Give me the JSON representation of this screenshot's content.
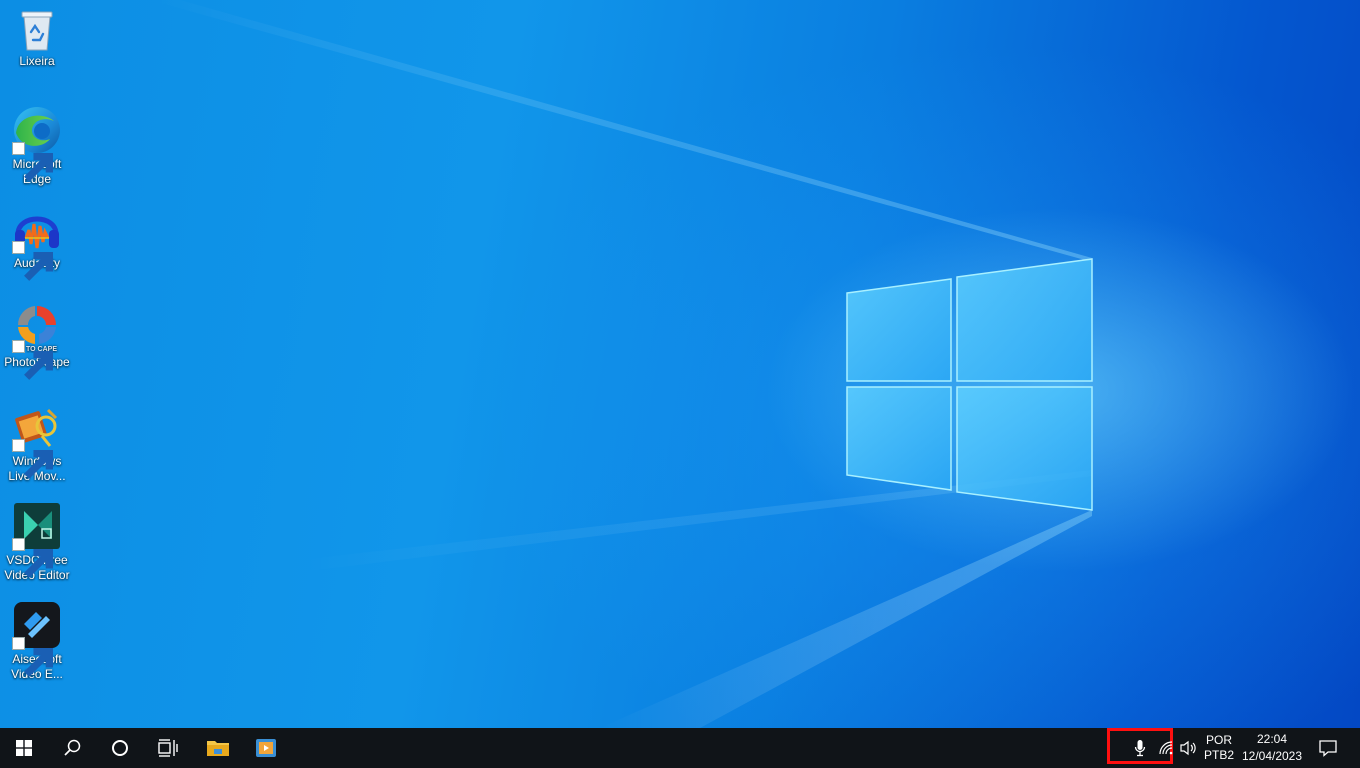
{
  "desktop": {
    "icons": [
      {
        "label": "Lixeira",
        "icon": "recycle-bin-icon"
      },
      {
        "label": "Microsoft Edge",
        "icon": "edge-icon"
      },
      {
        "label": "Audacity",
        "icon": "audacity-icon"
      },
      {
        "label": "PhotoScape",
        "icon": "photoscape-icon"
      },
      {
        "label": "Windows Live Mov...",
        "icon": "movie-maker-icon"
      },
      {
        "label": "VSDC Free Video Editor",
        "icon": "vsdc-icon"
      },
      {
        "label": "Aiseesoft Video E...",
        "icon": "aiseesoft-icon"
      }
    ],
    "photoscape_logo_text": "TO CAPE"
  },
  "taskbar": {
    "items": [
      "start-button",
      "search-icon",
      "cortana-icon",
      "task-view-icon",
      "file-explorer-icon",
      "media-app-icon"
    ],
    "tray": {
      "language_top": "POR",
      "language_bottom": "PTB2",
      "time": "22:04",
      "date": "12/04/2023"
    }
  },
  "colors": {
    "taskbar": "#101418",
    "highlight": "#ff1010",
    "wallpaper_accent": "#0a7ee0"
  }
}
